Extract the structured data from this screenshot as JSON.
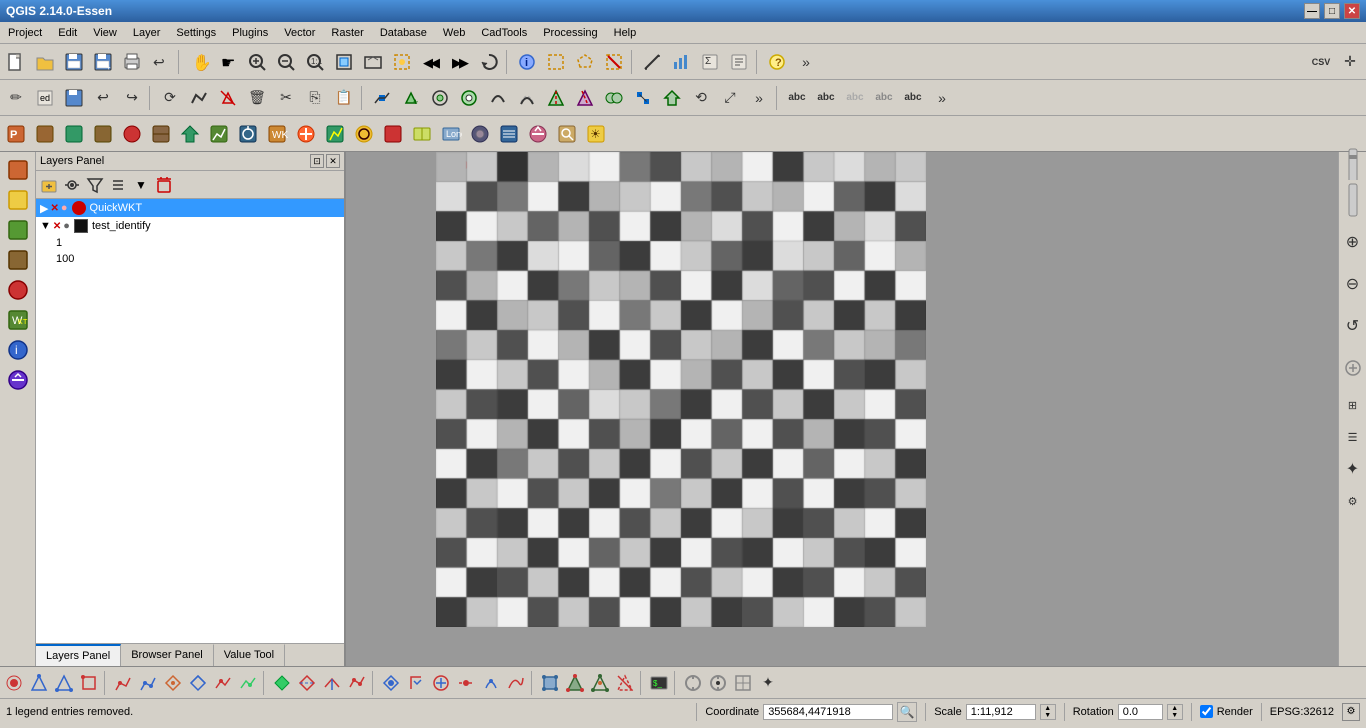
{
  "titlebar": {
    "title": "QGIS 2.14.0-Essen",
    "controls": [
      "minimize",
      "maximize",
      "close"
    ]
  },
  "menubar": {
    "items": [
      "Project",
      "Edit",
      "View",
      "Layer",
      "Settings",
      "Plugins",
      "Vector",
      "Raster",
      "Database",
      "Web",
      "CadTools",
      "Processing",
      "Help"
    ]
  },
  "layers_panel": {
    "title": "Layers Panel",
    "layers": [
      {
        "name": "QuickWKT",
        "checked": false,
        "color": "#cc0000",
        "type": "vector"
      },
      {
        "name": "test_identify",
        "checked": false,
        "color": "#000000",
        "type": "raster",
        "sublayers": [
          "1",
          "100"
        ]
      }
    ]
  },
  "panel_tabs": [
    "Layers Panel",
    "Browser Panel",
    "Value Tool"
  ],
  "statusbar": {
    "legend_msg": "1 legend entries removed.",
    "coordinate_label": "Coordinate",
    "coordinate_value": "355684,4471918",
    "scale_label": "Scale",
    "scale_value": "1:11,912",
    "rotation_label": "Rotation",
    "rotation_value": "0.0",
    "render_label": "Render",
    "epsg_label": "EPSG:32612"
  },
  "toolbar1": {
    "buttons": [
      "new",
      "open",
      "save",
      "save-as",
      "save-layer",
      "revert",
      "pan",
      "pan-map",
      "zoom-in-layer",
      "zoom-in",
      "zoom-out",
      "zoom-native",
      "zoom-extent",
      "zoom-layer",
      "zoom-prev",
      "zoom-next",
      "refresh",
      "identify",
      "select",
      "select-arrow",
      "deselect",
      "add-feature",
      "measure",
      "statistics",
      "summarize",
      "field-calc",
      "help",
      "more",
      "csv-export",
      "cursor"
    ]
  },
  "toolbar2": {
    "buttons": [
      "digitize",
      "edit",
      "save-edits",
      "undo",
      "redo",
      "rotate",
      "simplify",
      "delete-part",
      "delete",
      "cut",
      "copy",
      "paste",
      "vertex-tool",
      "add-part",
      "add-ring",
      "fill-ring",
      "reshape",
      "offset",
      "split",
      "split-parts",
      "merge",
      "node",
      "move",
      "rotate2",
      "scale",
      "more2",
      "text-label",
      "pin",
      "label-move",
      "more3",
      "more4"
    ]
  },
  "toolbar3": {
    "buttons": [
      "plugin1",
      "plugin2",
      "plugin3",
      "plugin4",
      "plugin5",
      "plugin6",
      "plugin7",
      "plugin8",
      "plugin9",
      "plugin10",
      "plugin11",
      "plugin12",
      "plugin13",
      "plugin14",
      "plugin15",
      "plugin16",
      "plugin17",
      "plugin18",
      "plugin19",
      "plugin20",
      "plugin21",
      "plugin22",
      "plugin23",
      "plugin24",
      "plugin25",
      "plugin26",
      "plugin27",
      "plugin28",
      "plugin29",
      "plugin30"
    ]
  },
  "bottom_toolbar": {
    "buttons": [
      "snap1",
      "snap2",
      "snap3",
      "snap4",
      "snap5",
      "snap6",
      "snap7",
      "snap8",
      "snap9",
      "snap10",
      "snap11",
      "snap12",
      "snap13",
      "snap14",
      "snap15",
      "snap16",
      "snap17",
      "snap18",
      "snap19",
      "snap20",
      "snap21",
      "snap22",
      "snap23",
      "snap24",
      "snap25",
      "snap26",
      "snap27",
      "snap28",
      "snap29",
      "snap30",
      "snap31",
      "snap32",
      "snap33",
      "snap34",
      "snap35",
      "snap36",
      "snap37",
      "snap38"
    ]
  },
  "icons": {
    "minimize": "—",
    "maximize": "□",
    "close": "✕",
    "new": "📄",
    "open": "📁",
    "save": "💾",
    "pan": "✋",
    "zoom-in": "🔍",
    "identify": "ℹ",
    "search": "🔎"
  }
}
